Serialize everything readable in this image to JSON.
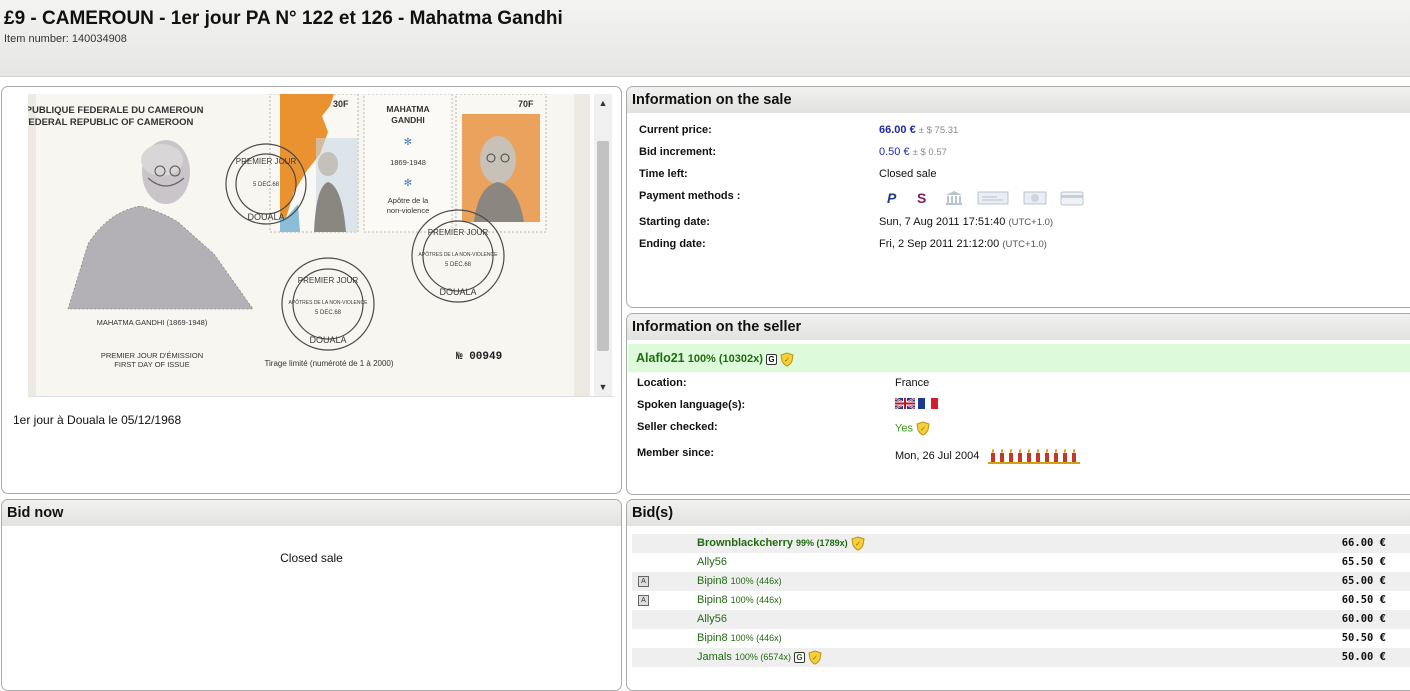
{
  "header": {
    "title": "£9 - CAMEROUN - 1er jour PA N° 122 et 126 - Mahatma Gandhi",
    "item_number": "Item number: 140034908"
  },
  "image": {
    "caption": "1er jour à Douala le 05/12/1968",
    "scroll_up": "▲",
    "scroll_down": "▼",
    "scan_text": {
      "republic_fr": "RÉPUBLIQUE FEDERALE DU CAMEROUN",
      "republic_en": "FEDERAL REPUBLIC OF CAMEROON",
      "portrait_caption": "MAHATMA GANDHI (1869-1948)",
      "first_day_fr": "PREMIER JOUR D'ÉMISSION",
      "first_day_en": "FIRST DAY OF ISSUE",
      "print_run": "Tirage limité (numéroté de 1 à 2000)",
      "serial": "№ 00949",
      "middle_name_1": "MAHATMA",
      "middle_name_2": "GANDHI",
      "middle_years": "1869-1948",
      "middle_motto_1": "Apôtre de la",
      "middle_motto_2": "non-violence",
      "stamp_left_value": "30F",
      "stamp_right_value": "70F",
      "postmark_top": "PREMIER JOUR",
      "postmark_mid": "APÔTRES DE LA NON-VIOLENCE",
      "postmark_date": "5 DEC.68",
      "postmark_city": "DOUALA"
    }
  },
  "sale": {
    "title": "Information on the sale",
    "rows": [
      {
        "label": "Current price:",
        "value": "66.00 €",
        "sub": "± $ 75.31"
      },
      {
        "label": "Bid increment:",
        "value": "0.50 €",
        "sub": "± $ 0.57"
      },
      {
        "label": "Time left:",
        "value": "Closed sale",
        "sub": ""
      },
      {
        "label": "Payment methods :",
        "value": "",
        "sub": ""
      },
      {
        "label": "Starting date:",
        "value": "Sun, 7 Aug 2011 17:51:40",
        "sub": "(UTC+1.0)"
      },
      {
        "label": "Ending date:",
        "value": "Fri, 2 Sep 2011 21:12:00",
        "sub": "(UTC+1.0)"
      }
    ],
    "payment_icons": [
      "paypal-icon",
      "skrill-icon",
      "bank-icon",
      "cheque-icon",
      "cash-icon",
      "card-icon"
    ]
  },
  "seller": {
    "title": "Information on the seller",
    "name": "Alaflo21",
    "rating": "100% (10302x)",
    "rows": [
      {
        "label": "Location:",
        "value": "France"
      },
      {
        "label": "Spoken language(s):",
        "value": ""
      },
      {
        "label": "Seller checked:",
        "value": "Yes"
      },
      {
        "label": "Member since:",
        "value": "Mon, 26 Jul 2004"
      }
    ],
    "languages": [
      "uk-flag-icon",
      "france-flag-icon"
    ],
    "seniority_candles": 10
  },
  "bid_now": {
    "title": "Bid now",
    "message": "Closed sale"
  },
  "bids": {
    "title": "Bid(s)",
    "rows": [
      {
        "bidder": "Brownblackcherry",
        "rating": "99% (1789x)",
        "amount": "66.00 €",
        "auto": false,
        "badge_g": false,
        "shield": true,
        "top": true
      },
      {
        "bidder": "Ally56",
        "rating": "",
        "amount": "65.50 €",
        "auto": false,
        "badge_g": false,
        "shield": false,
        "top": false
      },
      {
        "bidder": "Bipin8",
        "rating": "100% (446x)",
        "amount": "65.00 €",
        "auto": true,
        "badge_g": false,
        "shield": false,
        "top": false
      },
      {
        "bidder": "Bipin8",
        "rating": "100% (446x)",
        "amount": "60.50 €",
        "auto": true,
        "badge_g": false,
        "shield": false,
        "top": false
      },
      {
        "bidder": "Ally56",
        "rating": "",
        "amount": "60.00 €",
        "auto": false,
        "badge_g": false,
        "shield": false,
        "top": false
      },
      {
        "bidder": "Bipin8",
        "rating": "100% (446x)",
        "amount": "50.50 €",
        "auto": false,
        "badge_g": false,
        "shield": false,
        "top": false
      },
      {
        "bidder": "Jamals",
        "rating": "100% (6574x)",
        "amount": "50.00 €",
        "auto": false,
        "badge_g": true,
        "shield": true,
        "top": false
      }
    ],
    "auto_marker": "A"
  }
}
